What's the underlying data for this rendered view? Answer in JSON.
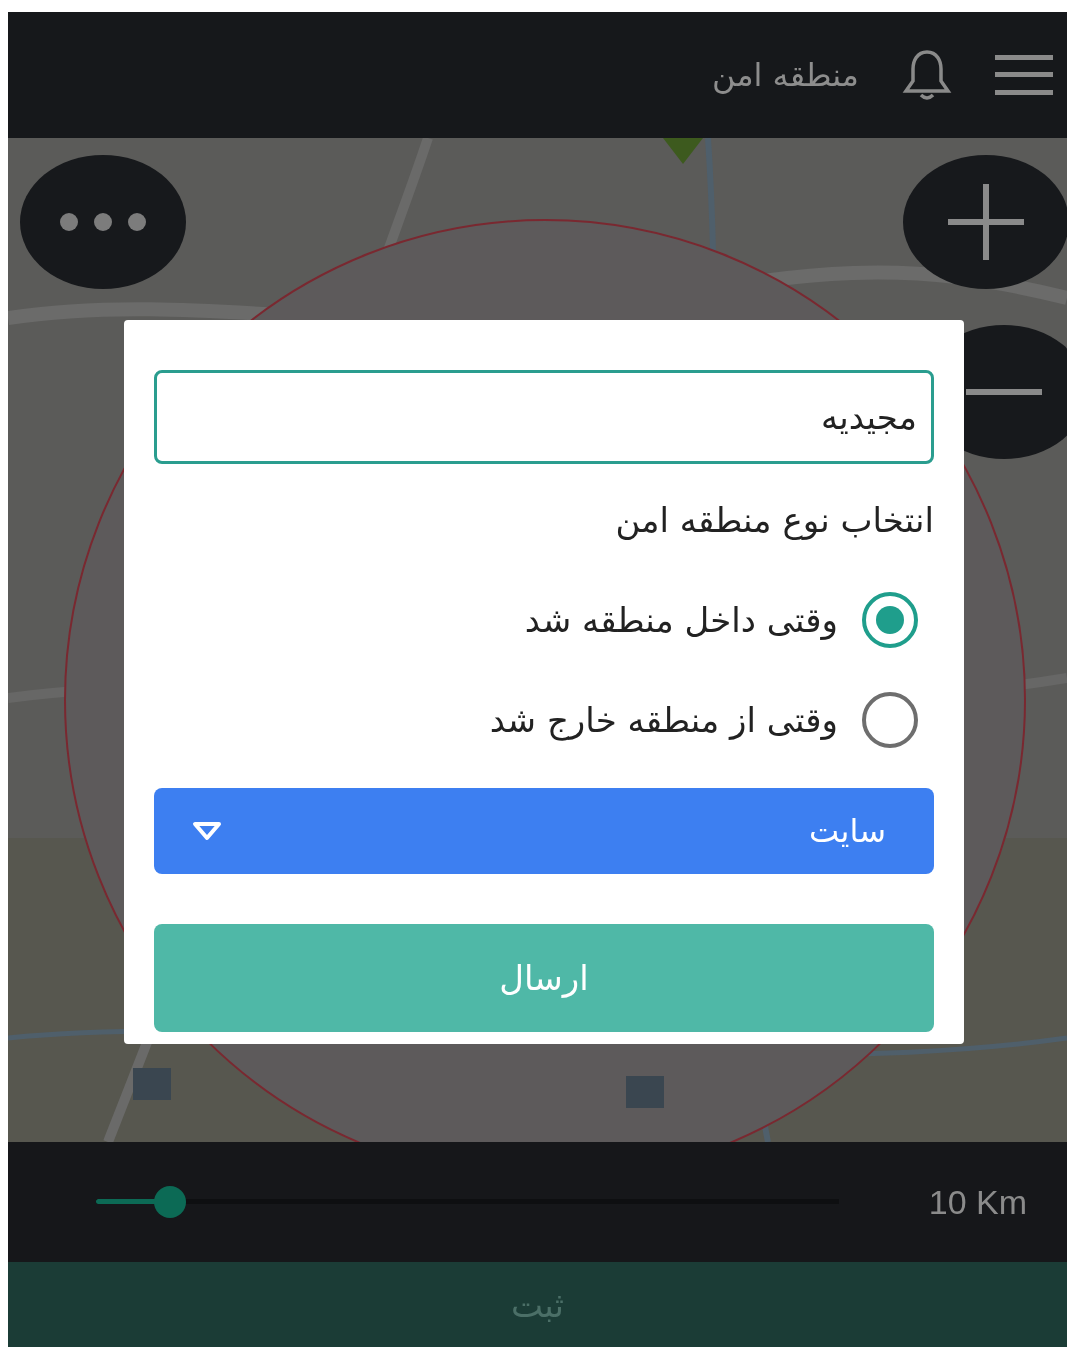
{
  "header": {
    "title": "منطقه امن"
  },
  "dialog": {
    "name_field": {
      "value": "مجیدیه"
    },
    "heading": "انتخاب نوع منطقه امن",
    "options": [
      {
        "label": "وقتی داخل منطقه شد",
        "selected": true
      },
      {
        "label": "وقتی از منطقه خارج شد",
        "selected": false
      }
    ],
    "dropdown": {
      "value": "سایت"
    },
    "submit": "ارسال"
  },
  "radius": {
    "level": 0.1,
    "reading": "10 Km"
  },
  "save_button": "ثبت"
}
